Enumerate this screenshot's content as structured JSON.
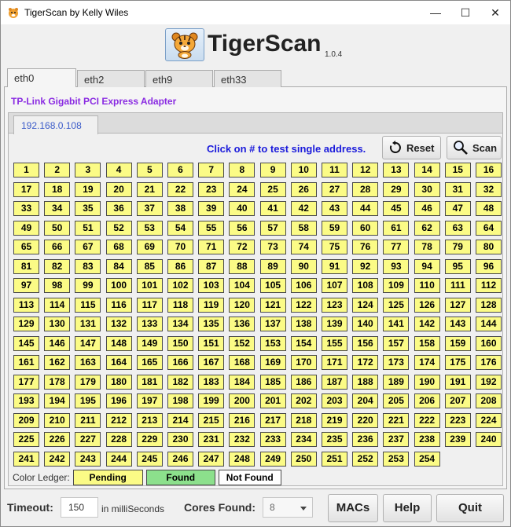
{
  "window": {
    "title": "TigerScan by Kelly Wiles",
    "controls": [
      "—",
      "☐",
      "✕"
    ]
  },
  "header": {
    "app_name": "TigerScan",
    "version": "1.0.4"
  },
  "interface_tabs": [
    {
      "label": "eth0",
      "active": true
    },
    {
      "label": "eth2",
      "active": false
    },
    {
      "label": "eth9",
      "active": false
    },
    {
      "label": "eth33",
      "active": false
    }
  ],
  "adapter_name": "TP-Link Gigabit PCI Express Adapter",
  "subnet_tabs": [
    {
      "label": "192.168.0.108",
      "active": true
    }
  ],
  "instruction": "Click on # to test single address.",
  "toolbar": {
    "reset_label": "Reset",
    "scan_label": "Scan"
  },
  "address_count": 254,
  "address_state": "Pending",
  "legend": {
    "label": "Color Ledger:",
    "pending": "Pending",
    "found": "Found",
    "not_found": "Not Found"
  },
  "colors": {
    "pending": "#fbfb86",
    "found": "#8ce08c",
    "not_found": "#ffffff",
    "adapter_text": "#8a2be2",
    "instruction_text": "#1a1adb"
  },
  "footer": {
    "timeout_label": "Timeout:",
    "timeout_value": "150",
    "timeout_unit": "in milliSeconds",
    "cores_label": "Cores Found:",
    "cores_value": "8",
    "macs_label": "MACs",
    "help_label": "Help",
    "quit_label": "Quit"
  }
}
